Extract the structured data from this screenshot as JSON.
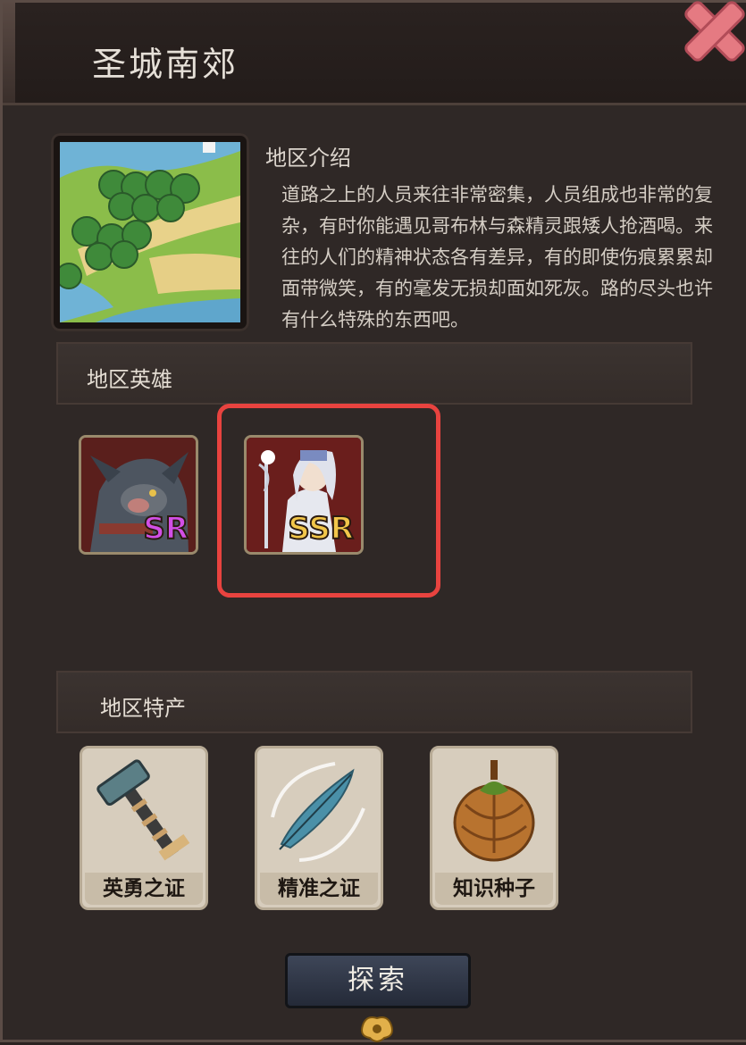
{
  "header": {
    "title": "圣城南郊"
  },
  "intro": {
    "title": "地区介绍",
    "text": "道路之上的人员来往非常密集，人员组成也非常的复杂，有时你能遇见哥布林与森精灵跟矮人抢酒喝。来往的人们的精神状态各有差异，有的即使伤痕累累却面带微笑，有的毫发无损却面如死灰。路的尽头也许有什么特殊的东西吧。"
  },
  "heroes_section": {
    "label": "地区英雄",
    "heroes": [
      {
        "rarity": "SR",
        "icon": "rat-warrior-portrait"
      },
      {
        "rarity": "SSR",
        "icon": "white-priestess-portrait"
      }
    ]
  },
  "products_section": {
    "label": "地区特产",
    "items": [
      {
        "label": "英勇之证",
        "icon": "hammer-icon"
      },
      {
        "label": "精准之证",
        "icon": "feather-icon"
      },
      {
        "label": "知识种子",
        "icon": "seed-icon"
      }
    ]
  },
  "actions": {
    "explore_label": "探索"
  },
  "colors": {
    "highlight": "#e8433f",
    "sr": "#d24fe6",
    "ssr": "#f2c64a",
    "close": "#e57a82"
  }
}
